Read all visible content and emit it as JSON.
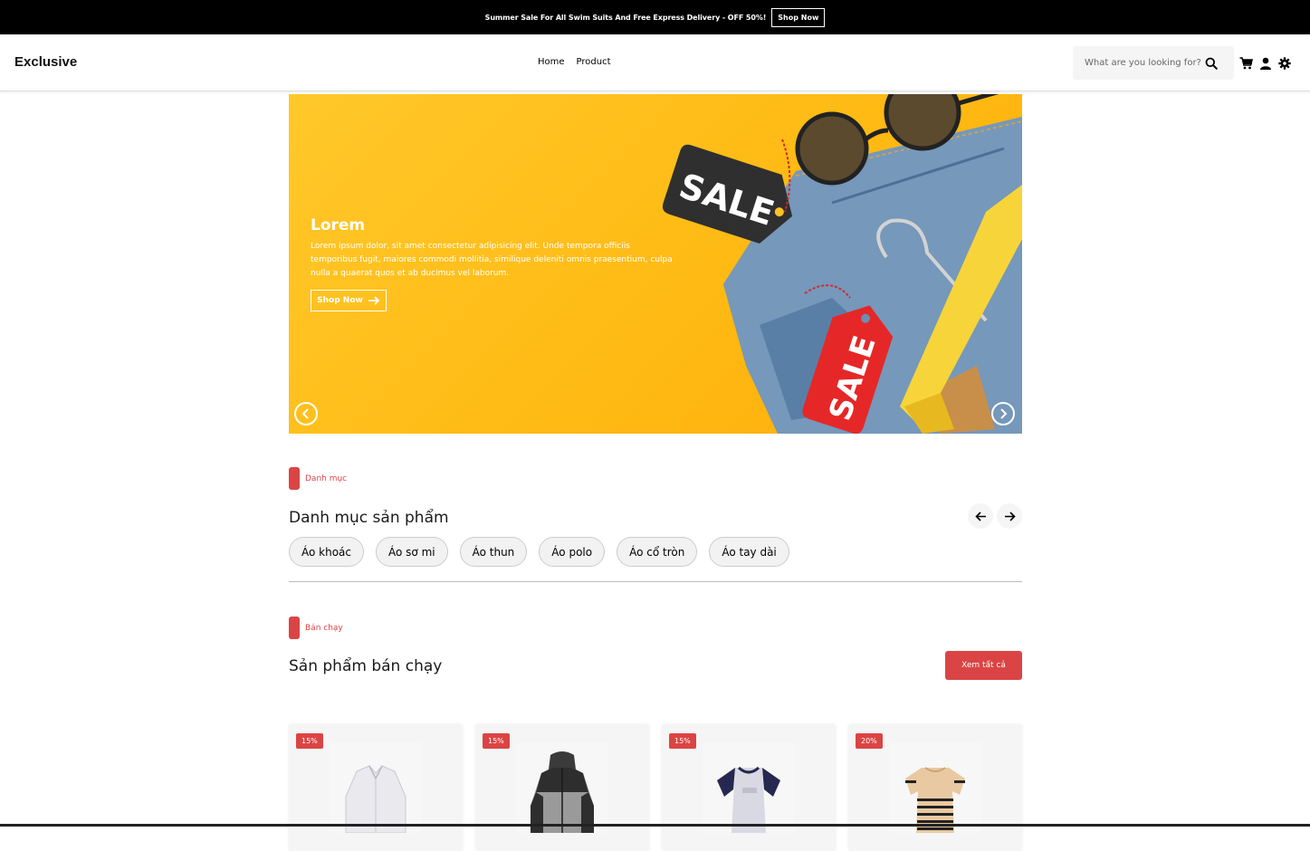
{
  "announcement": {
    "text": "Summer Sale For All Swim Suits And Free Express Delivery - OFF 50%!",
    "button": "Shop Now"
  },
  "header": {
    "logo": "Exclusive",
    "nav": [
      {
        "label": "Home"
      },
      {
        "label": "Product"
      }
    ],
    "search_placeholder": "What are you looking for?",
    "icons": [
      "cart-icon",
      "user-icon",
      "settings-icon"
    ]
  },
  "banner": {
    "title": "Lorem",
    "description": "Lorem ipsum dolor, sit amet consectetur adipisicing elit. Unde tempora officiis temporibus fugit, maiores commodi mollitia, similique deleniti omnis praesentium, culpa nulla a quaerat quos et ab ducimus vel laborum.",
    "button": "Shop Now",
    "tag_text": "SALE"
  },
  "categories": {
    "tag": "Danh mục",
    "title": "Danh mục sản phẩm",
    "items": [
      {
        "label": "Áo khoác"
      },
      {
        "label": "Áo sơ mi"
      },
      {
        "label": "Áo thun"
      },
      {
        "label": "Áo polo"
      },
      {
        "label": "Áo cổ tròn"
      },
      {
        "label": "Áo tay dài"
      }
    ]
  },
  "bestsellers": {
    "tag": "Bán chạy",
    "title": "Sản phẩm bán chạy",
    "view_all": "Xem tất cả",
    "products": [
      {
        "discount": "15%",
        "image": "white-shirt"
      },
      {
        "discount": "15%",
        "image": "grey-jacket"
      },
      {
        "discount": "15%",
        "image": "raglan-tshirt"
      },
      {
        "discount": "20%",
        "image": "striped-tshirt"
      }
    ]
  },
  "colors": {
    "accent": "#db4444",
    "banner": "#ffc21f",
    "topbar": "#000000"
  }
}
